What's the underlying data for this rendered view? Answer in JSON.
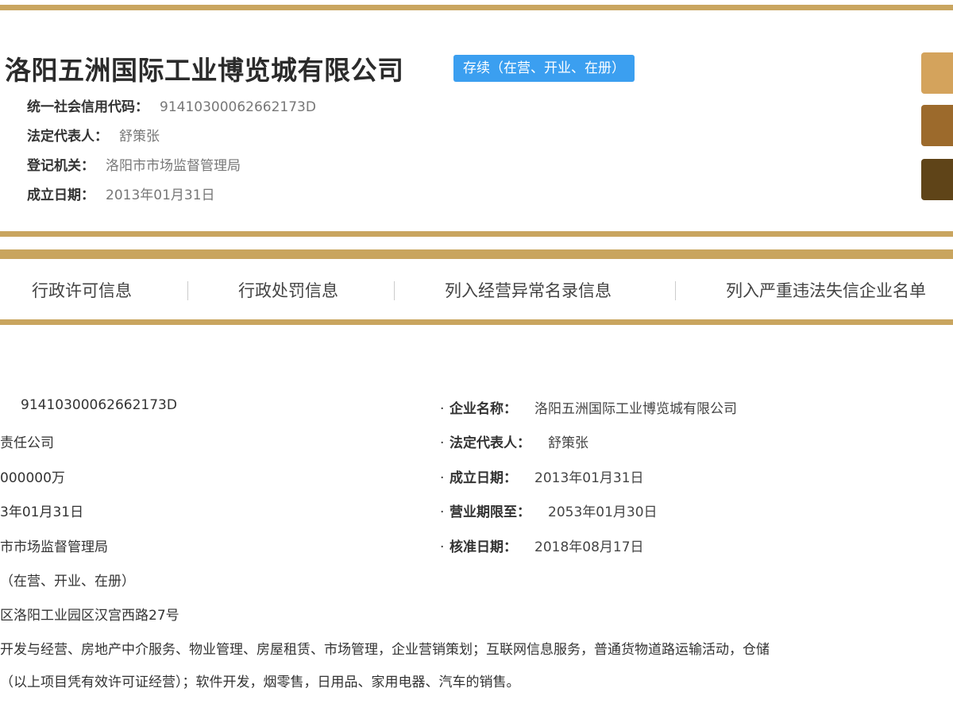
{
  "header": {
    "company_name": "洛阳五洲国际工业博览城有限公司",
    "status": "存续（在营、开业、在册）",
    "fields": [
      {
        "label": "统一社会信用代码：",
        "value": "91410300062662173D"
      },
      {
        "label": "法定代表人：",
        "value": "舒策张"
      },
      {
        "label": "登记机关：",
        "value": "洛阳市市场监督管理局"
      },
      {
        "label": "成立日期：",
        "value": "2013年01月31日"
      }
    ]
  },
  "colors": {
    "accent_gold": "#c9a55f",
    "status_blue": "#3b9ff0",
    "side_button_1": "#d4a35c",
    "side_button_2": "#9c6a2c",
    "side_button_3": "#5f4418"
  },
  "tabs": [
    {
      "label": "行政许可信息"
    },
    {
      "label": "行政处罚信息"
    },
    {
      "label": "列入经营异常名录信息"
    },
    {
      "label": "列入严重违法失信企业名单"
    }
  ],
  "details": {
    "left": [
      "91410300062662173D",
      "责任公司",
      "000000万",
      "3年01月31日",
      "市市场监督管理局",
      "（在营、开业、在册）",
      "区洛阳工业园区汉宫西路27号"
    ],
    "right": [
      {
        "label": "企业名称：",
        "value": "洛阳五洲国际工业博览城有限公司"
      },
      {
        "label": "法定代表人：",
        "value": "舒策张"
      },
      {
        "label": "成立日期：",
        "value": "2013年01月31日"
      },
      {
        "label": "营业期限至：",
        "value": "2053年01月30日"
      },
      {
        "label": "核准日期：",
        "value": "2018年08月17日"
      }
    ],
    "scope_line1": "开发与经营、房地产中介服务、物业管理、房屋租赁、市场管理，企业营销策划；互联网信息服务，普通货物道路运输活动，仓储",
    "scope_line2": "（以上项目凭有效许可证经营）；软件开发，烟零售，日用品、家用电器、汽车的销售。"
  }
}
